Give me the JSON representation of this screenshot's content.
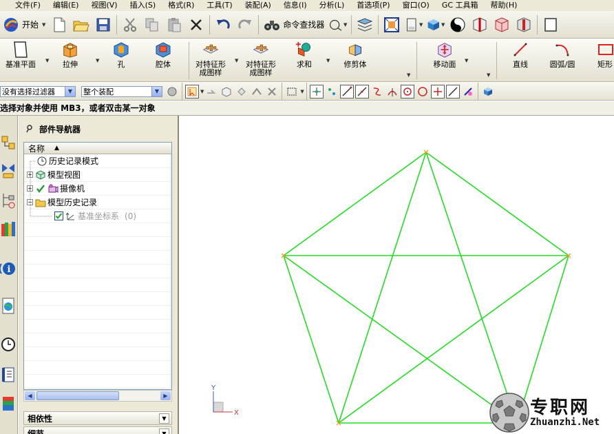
{
  "menubar": {
    "items": [
      "文件(F)",
      "编辑(E)",
      "视图(V)",
      "插入(S)",
      "格式(R)",
      "工具(T)",
      "装配(A)",
      "信息(I)",
      "分析(L)",
      "首选项(P)",
      "窗口(O)",
      "GC 工具箱",
      "帮助(H)"
    ]
  },
  "toolbar1": {
    "start_label": "开始",
    "command_finder_label": "命令查找器"
  },
  "toolbar2": {
    "datum_plane": "基准平面",
    "extrude": "拉伸",
    "hole": "孔",
    "pocket": "腔体",
    "pattern_feature_line1": "对特征形",
    "pattern_feature_line2": "成图样",
    "pattern_face_line1": "对特征形",
    "pattern_face_line2": "成图样",
    "unite": "求和",
    "trim_body": "修剪体",
    "move_face": "移动面",
    "line": "直线",
    "arc": "圆弧/圆",
    "rectangle": "矩形"
  },
  "selbar": {
    "filter_value": "没有选择过滤器",
    "scope_value": "整个装配"
  },
  "cueline": {
    "text": "选择对象并使用 MB3，或者双击某一对象"
  },
  "navigator": {
    "title": "部件导航器",
    "column_name": "名称",
    "nodes": [
      {
        "label": "历史记录模式"
      },
      {
        "label": "模型视图"
      },
      {
        "label": "摄像机"
      },
      {
        "label": "模型历史记录"
      },
      {
        "label": "基准坐标系",
        "suffix": "(0)"
      }
    ],
    "section_dependencies": "相依性",
    "section_details": "细节"
  },
  "graphics": {
    "curve_color": "#22dd22",
    "point_color": "#e8a02a",
    "triad_x": "X",
    "triad_y": "Y"
  },
  "watermark": {
    "text": "专职网",
    "url": "Zhuanzhi.Net"
  }
}
